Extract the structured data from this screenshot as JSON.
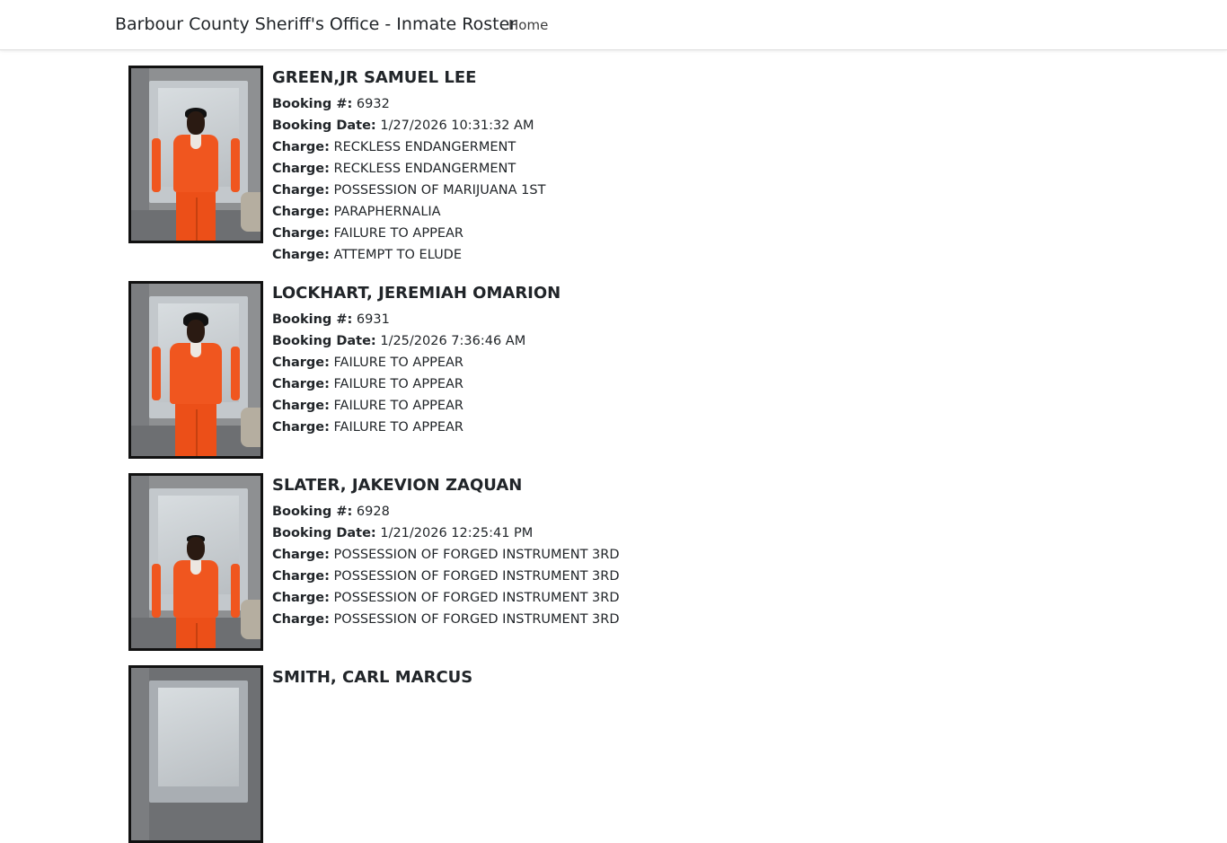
{
  "navbar": {
    "brand": "Barbour County Sheriff's Office - Inmate Roster",
    "home": "Home"
  },
  "labels": {
    "booking_no": "Booking #:",
    "booking_date": "Booking Date:",
    "charge": "Charge:"
  },
  "inmates": [
    {
      "name": "GREEN,JR SAMUEL LEE",
      "booking_no": "6932",
      "booking_date": "1/27/2026 10:31:32 AM",
      "charges": [
        "RECKLESS ENDANGERMENT",
        "RECKLESS ENDANGERMENT",
        "POSSESSION OF MARIJUANA 1ST",
        "PARAPHERNALIA",
        "FAILURE TO APPEAR",
        "ATTEMPT TO ELUDE"
      ]
    },
    {
      "name": "LOCKHART, JEREMIAH OMARION",
      "booking_no": "6931",
      "booking_date": "1/25/2026 7:36:46 AM",
      "charges": [
        "FAILURE TO APPEAR",
        "FAILURE TO APPEAR",
        "FAILURE TO APPEAR",
        "FAILURE TO APPEAR"
      ]
    },
    {
      "name": "SLATER, JAKEVION ZAQUAN",
      "booking_no": "6928",
      "booking_date": "1/21/2026 12:25:41 PM",
      "charges": [
        "POSSESSION OF FORGED INSTRUMENT 3RD",
        "POSSESSION OF FORGED INSTRUMENT 3RD",
        "POSSESSION OF FORGED INSTRUMENT 3RD",
        "POSSESSION OF FORGED INSTRUMENT 3RD"
      ]
    },
    {
      "name": "SMITH, CARL MARCUS",
      "booking_no": "",
      "booking_date": "",
      "charges": []
    }
  ]
}
